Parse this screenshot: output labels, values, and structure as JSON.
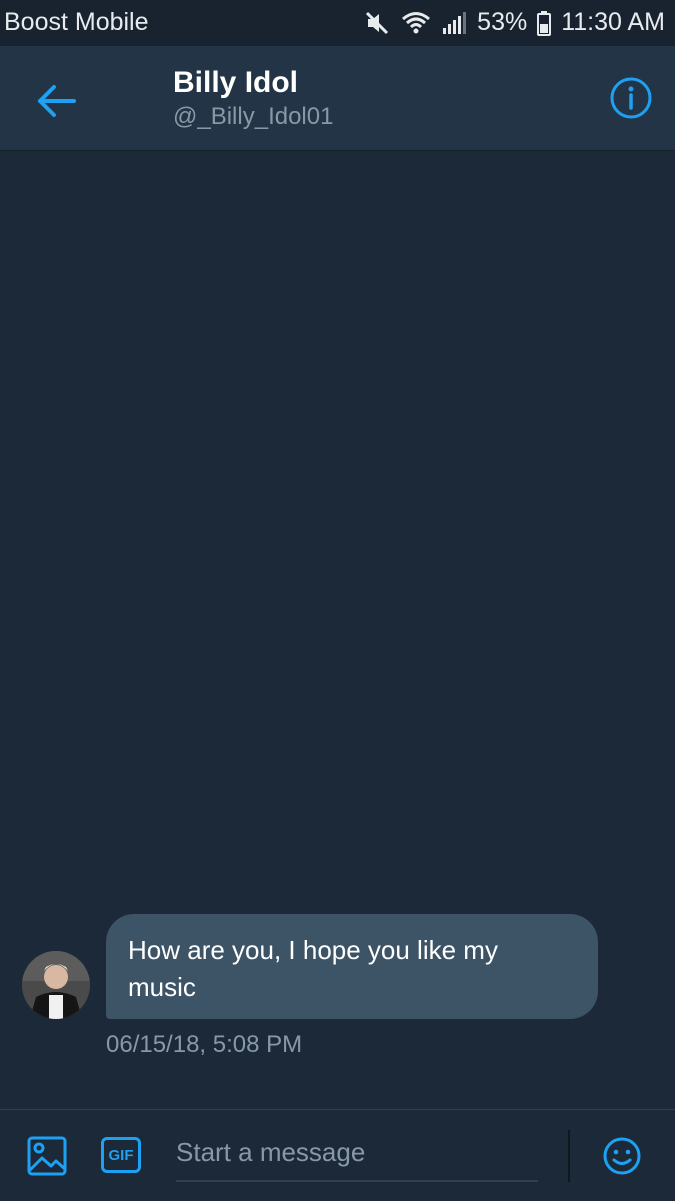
{
  "status_bar": {
    "carrier": "Boost Mobile",
    "battery": "53%",
    "time": "11:30 AM",
    "icons": [
      "mute-icon",
      "wifi-icon",
      "signal-icon",
      "battery-icon"
    ]
  },
  "header": {
    "title": "Billy Idol",
    "handle": "@_Billy_Idol01",
    "back_icon": "arrow-left-icon",
    "info_icon": "info-icon"
  },
  "messages": [
    {
      "text": "How are you,  I hope you like my music",
      "timestamp": "06/15/18, 5:08 PM"
    }
  ],
  "composer": {
    "placeholder": "Start a message",
    "media_icon": "image-icon",
    "gif_label": "GIF",
    "emoji_icon": "smiley-icon"
  },
  "colors": {
    "background": "#1c2938",
    "header": "#243447",
    "bubble": "#3d5467",
    "accent": "#1da1f2",
    "muted_text": "#8899a6"
  }
}
